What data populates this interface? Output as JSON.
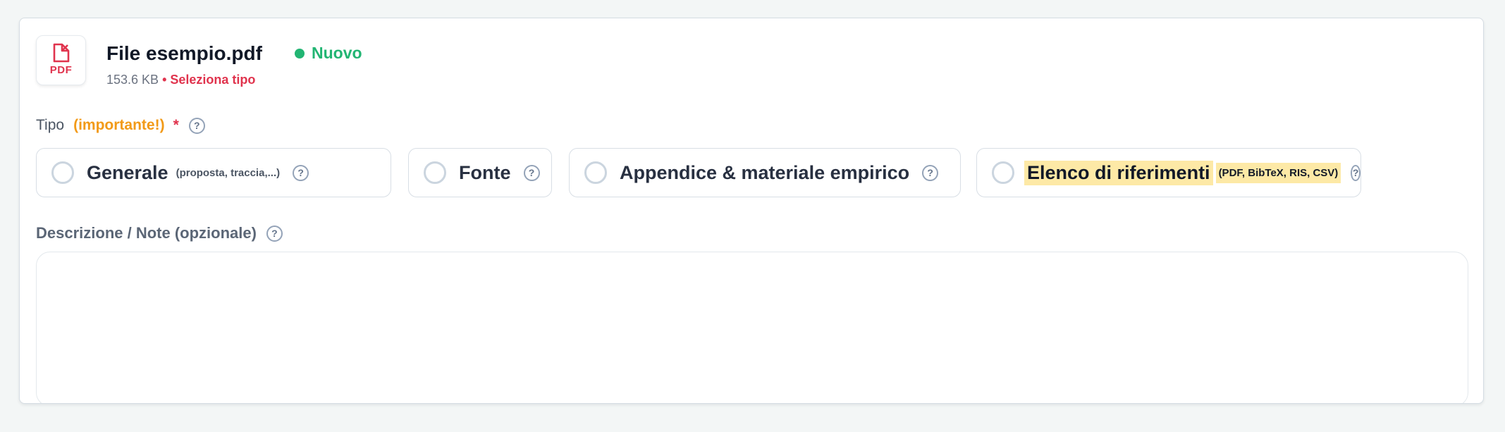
{
  "file": {
    "icon": "pdf-file-icon",
    "icon_label": "PDF",
    "name": "File esempio.pdf",
    "status": "Nuovo",
    "status_color": "#22b573",
    "size": "153.6 KB",
    "warning": "• Seleziona tipo",
    "warning_color": "#e0334d"
  },
  "tipo": {
    "label": "Tipo",
    "important": "(importante!)",
    "required_mark": "*",
    "help": "?",
    "options": [
      {
        "label": "Generale",
        "sub": "(proposta, traccia,...)",
        "help": "?"
      },
      {
        "label": "Fonte",
        "help": "?"
      },
      {
        "label": "Appendice & materiale empirico",
        "help": "?"
      },
      {
        "label": "Elenco di riferimenti",
        "sub": "(PDF, BibTeX, RIS, CSV)",
        "help": "?",
        "highlighted": true
      }
    ]
  },
  "description": {
    "label": "Descrizione / Note (opzionale)",
    "help": "?",
    "value": ""
  }
}
